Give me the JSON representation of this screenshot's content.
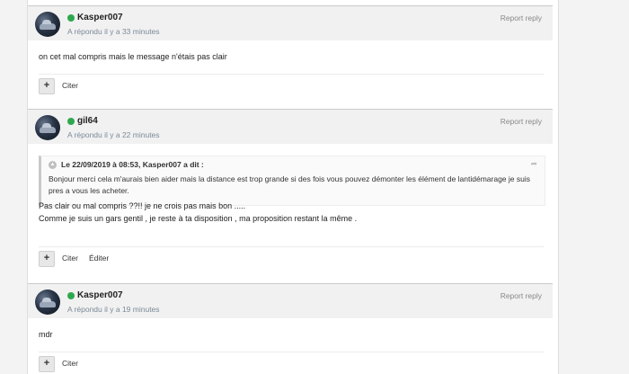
{
  "posts": [
    {
      "username": "Kasper007",
      "time": "A répondu il y a 33 minutes",
      "report": "Report reply",
      "body": "on cet mal compris mais le message n'étais pas clair",
      "actions": {
        "plus": "+",
        "quote": "Citer"
      }
    },
    {
      "username": "gil64",
      "time": "A répondu il y a 22 minutes",
      "report": "Report reply",
      "quote": {
        "header": "Le 22/09/2019 à 08:53, Kasper007 a dit :",
        "text": "Bonjour merci cela m'aurais bien aider mais la distance est trop grande si des fois vous pouvez démonter les élément de lantidémarage je suis pres a vous les acheter."
      },
      "body_lines": [
        "Pas clair ou mal compris ??!! je ne crois pas mais bon .....",
        "Comme je suis un gars gentil , je reste à ta disposition , ma proposition restant la même ."
      ],
      "actions": {
        "plus": "+",
        "quote": "Citer",
        "edit": "Éditer"
      }
    },
    {
      "username": "Kasper007",
      "time": "A répondu il y a 19 minutes",
      "report": "Report reply",
      "body": "mdr",
      "actions": {
        "plus": "+",
        "quote": "Citer"
      }
    }
  ],
  "colors": {
    "online": "#2ea84f",
    "meta": "#7a8a99"
  }
}
